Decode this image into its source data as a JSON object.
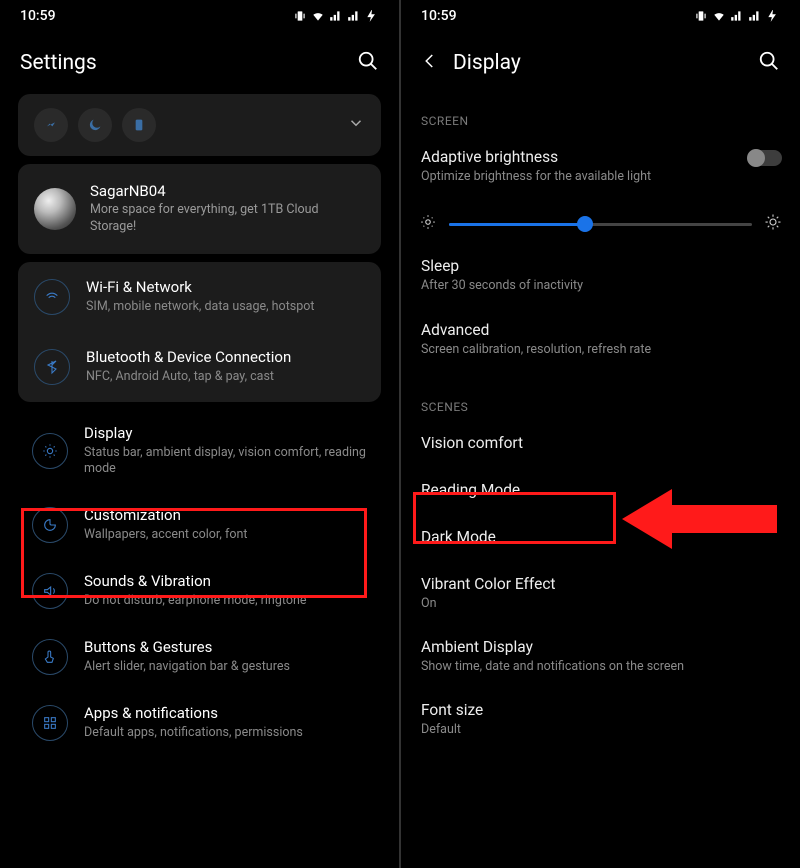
{
  "status": {
    "time": "10:59"
  },
  "left": {
    "title": "Settings",
    "user": {
      "name": "SagarNB04",
      "sub": "More space for everything, get 1TB Cloud Storage!"
    },
    "group1": [
      {
        "title": "Wi-Fi & Network",
        "sub": "SIM, mobile network, data usage, hotspot"
      },
      {
        "title": "Bluetooth & Device Connection",
        "sub": "NFC, Android Auto, tap & pay, cast"
      }
    ],
    "rows": [
      {
        "title": "Display",
        "sub": "Status bar, ambient display, vision comfort, reading mode"
      },
      {
        "title": "Customization",
        "sub": "Wallpapers, accent color, font"
      },
      {
        "title": "Sounds & Vibration",
        "sub": "Do not disturb, earphone mode, ringtone"
      },
      {
        "title": "Buttons & Gestures",
        "sub": "Alert slider, navigation bar & gestures"
      },
      {
        "title": "Apps & notifications",
        "sub": "Default apps, notifications, permissions"
      }
    ]
  },
  "right": {
    "title": "Display",
    "screen_label": "SCREEN",
    "scenes_label": "SCENES",
    "adaptive": {
      "title": "Adaptive brightness",
      "sub": "Optimize brightness for the available light"
    },
    "sleep": {
      "title": "Sleep",
      "sub": "After 30 seconds of inactivity"
    },
    "advanced": {
      "title": "Advanced",
      "sub": "Screen calibration, resolution, refresh rate"
    },
    "scenes": [
      {
        "title": "Vision comfort",
        "sub": ""
      },
      {
        "title": "Reading Mode",
        "sub": ""
      },
      {
        "title": "Dark Mode",
        "sub": ""
      },
      {
        "title": "Vibrant Color Effect",
        "sub": "On"
      },
      {
        "title": "Ambient Display",
        "sub": "Show time, date and notifications on the screen"
      },
      {
        "title": "Font size",
        "sub": "Default"
      }
    ]
  }
}
